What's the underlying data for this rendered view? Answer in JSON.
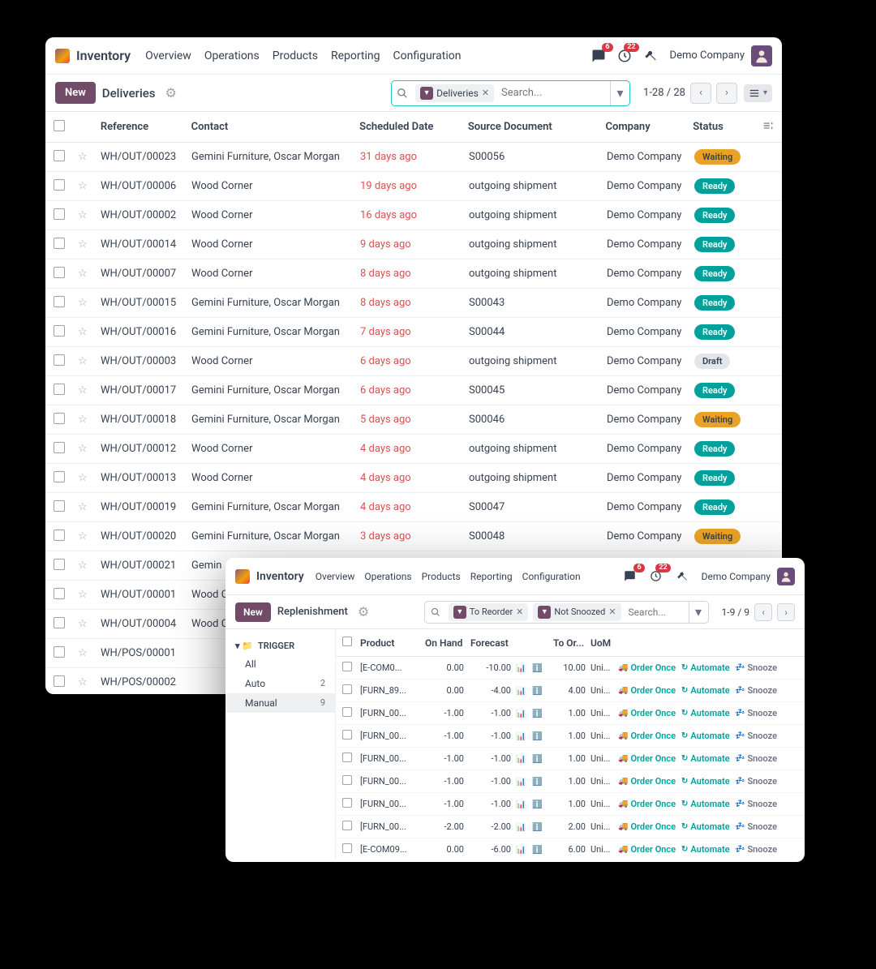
{
  "header": {
    "app_title": "Inventory",
    "nav": [
      "Overview",
      "Operations",
      "Products",
      "Reporting",
      "Configuration"
    ],
    "msg_badge": "6",
    "activity_badge": "22",
    "company": "Demo Company"
  },
  "deliveries": {
    "new_label": "New",
    "title": "Deliveries",
    "filter_chip": "Deliveries",
    "search_placeholder": "Search...",
    "pager": "1-28 / 28",
    "columns": {
      "ref": "Reference",
      "contact": "Contact",
      "date": "Scheduled Date",
      "src": "Source Document",
      "company": "Company",
      "status": "Status"
    },
    "rows": [
      {
        "ref": "WH/OUT/00023",
        "contact": "Gemini Furniture, Oscar Morgan",
        "date": "31 days ago",
        "src": "S00056",
        "company": "Demo Company",
        "status": "Waiting"
      },
      {
        "ref": "WH/OUT/00006",
        "contact": "Wood Corner",
        "date": "19 days ago",
        "src": "outgoing shipment",
        "company": "Demo Company",
        "status": "Ready"
      },
      {
        "ref": "WH/OUT/00002",
        "contact": "Wood Corner",
        "date": "16 days ago",
        "src": "outgoing shipment",
        "company": "Demo Company",
        "status": "Ready"
      },
      {
        "ref": "WH/OUT/00014",
        "contact": "Wood Corner",
        "date": "9 days ago",
        "src": "outgoing shipment",
        "company": "Demo Company",
        "status": "Ready"
      },
      {
        "ref": "WH/OUT/00007",
        "contact": "Wood Corner",
        "date": "8 days ago",
        "src": "outgoing shipment",
        "company": "Demo Company",
        "status": "Ready"
      },
      {
        "ref": "WH/OUT/00015",
        "contact": "Gemini Furniture, Oscar Morgan",
        "date": "8 days ago",
        "src": "S00043",
        "company": "Demo Company",
        "status": "Ready"
      },
      {
        "ref": "WH/OUT/00016",
        "contact": "Gemini Furniture, Oscar Morgan",
        "date": "7 days ago",
        "src": "S00044",
        "company": "Demo Company",
        "status": "Ready"
      },
      {
        "ref": "WH/OUT/00003",
        "contact": "Wood Corner",
        "date": "6 days ago",
        "src": "outgoing shipment",
        "company": "Demo Company",
        "status": "Draft"
      },
      {
        "ref": "WH/OUT/00017",
        "contact": "Gemini Furniture, Oscar Morgan",
        "date": "6 days ago",
        "src": "S00045",
        "company": "Demo Company",
        "status": "Ready"
      },
      {
        "ref": "WH/OUT/00018",
        "contact": "Gemini Furniture, Oscar Morgan",
        "date": "5 days ago",
        "src": "S00046",
        "company": "Demo Company",
        "status": "Waiting"
      },
      {
        "ref": "WH/OUT/00012",
        "contact": "Wood Corner",
        "date": "4 days ago",
        "src": "outgoing shipment",
        "company": "Demo Company",
        "status": "Ready"
      },
      {
        "ref": "WH/OUT/00013",
        "contact": "Wood Corner",
        "date": "4 days ago",
        "src": "outgoing shipment",
        "company": "Demo Company",
        "status": "Ready"
      },
      {
        "ref": "WH/OUT/00019",
        "contact": "Gemini Furniture, Oscar Morgan",
        "date": "4 days ago",
        "src": "S00047",
        "company": "Demo Company",
        "status": "Ready"
      },
      {
        "ref": "WH/OUT/00020",
        "contact": "Gemini Furniture, Oscar Morgan",
        "date": "3 days ago",
        "src": "S00048",
        "company": "Demo Company",
        "status": "Waiting"
      },
      {
        "ref": "WH/OUT/00021",
        "contact": "Gemin",
        "date": "",
        "src": "",
        "company": "",
        "status": ""
      },
      {
        "ref": "WH/OUT/00001",
        "contact": "Wood C",
        "date": "",
        "src": "",
        "company": "",
        "status": ""
      },
      {
        "ref": "WH/OUT/00004",
        "contact": "Wood C",
        "date": "",
        "src": "",
        "company": "",
        "status": ""
      },
      {
        "ref": "WH/POS/00001",
        "contact": "",
        "date": "",
        "src": "",
        "company": "",
        "status": ""
      },
      {
        "ref": "WH/POS/00002",
        "contact": "",
        "date": "",
        "src": "",
        "company": "",
        "status": ""
      }
    ]
  },
  "replenish": {
    "new_label": "New",
    "title": "Replenishment",
    "chip1": "To Reorder",
    "chip2": "Not Snoozed",
    "search_placeholder": "Search...",
    "pager": "1-9 / 9",
    "sidebar": {
      "header": "TRIGGER",
      "items": [
        {
          "label": "All",
          "count": ""
        },
        {
          "label": "Auto",
          "count": "2"
        },
        {
          "label": "Manual",
          "count": "9"
        }
      ]
    },
    "columns": {
      "product": "Product",
      "onhand": "On Hand",
      "forecast": "Forecast",
      "toorder": "To Or...",
      "uom": "UoM"
    },
    "btn_order": "Order Once",
    "btn_auto": "Automate",
    "btn_snooze": "Snooze",
    "rows": [
      {
        "product": "[E-COM0...",
        "onhand": "0.00",
        "forecast": "-10.00",
        "toorder": "10.00",
        "uom": "Uni..."
      },
      {
        "product": "[FURN_89...",
        "onhand": "0.00",
        "forecast": "-4.00",
        "toorder": "4.00",
        "uom": "Uni..."
      },
      {
        "product": "[FURN_00...",
        "onhand": "-1.00",
        "forecast": "-1.00",
        "toorder": "1.00",
        "uom": "Uni..."
      },
      {
        "product": "[FURN_00...",
        "onhand": "-1.00",
        "forecast": "-1.00",
        "toorder": "1.00",
        "uom": "Uni..."
      },
      {
        "product": "[FURN_00...",
        "onhand": "-1.00",
        "forecast": "-1.00",
        "toorder": "1.00",
        "uom": "Uni..."
      },
      {
        "product": "[FURN_00...",
        "onhand": "-1.00",
        "forecast": "-1.00",
        "toorder": "1.00",
        "uom": "Uni..."
      },
      {
        "product": "[FURN_00...",
        "onhand": "-1.00",
        "forecast": "-1.00",
        "toorder": "1.00",
        "uom": "Uni..."
      },
      {
        "product": "[FURN_00...",
        "onhand": "-2.00",
        "forecast": "-2.00",
        "toorder": "2.00",
        "uom": "Uni..."
      },
      {
        "product": "[E-COM09...",
        "onhand": "0.00",
        "forecast": "-6.00",
        "toorder": "6.00",
        "uom": "Uni..."
      }
    ]
  }
}
